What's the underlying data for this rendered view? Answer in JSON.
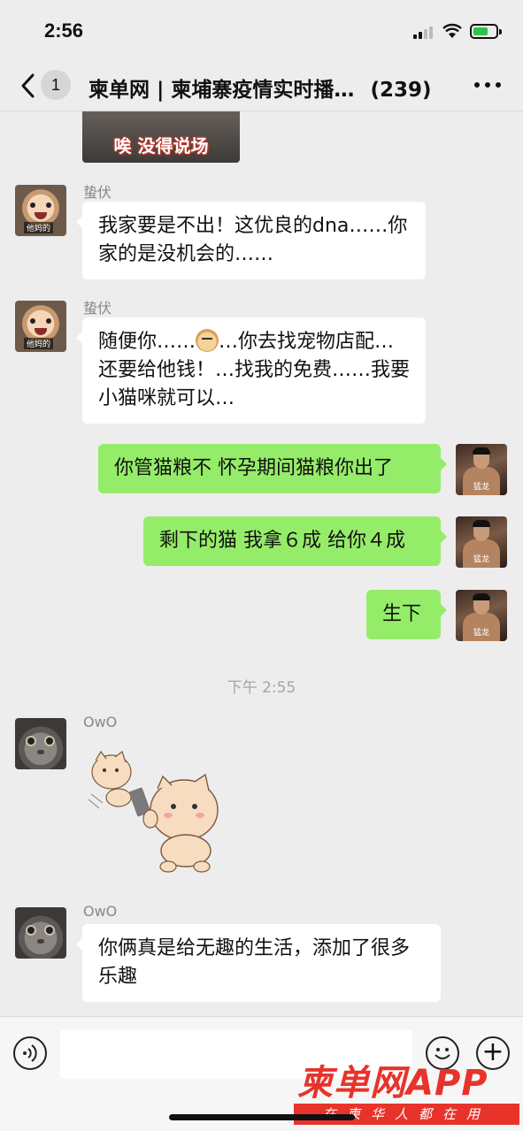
{
  "status_bar": {
    "time": "2:56"
  },
  "header": {
    "unread_count": "1",
    "title": "柬单网 | 柬埔寨疫情实时播…",
    "member_count": "(239)"
  },
  "messages": {
    "sticker_top_caption": "唉 没得说场",
    "msg1": {
      "sender": "蛰伏",
      "text": "我家要是不出！这优良的dna……你家的是没机会的……"
    },
    "msg2": {
      "sender": "蛰伏",
      "text_before": "随便你……",
      "text_after": "…你去找宠物店配…还要给他钱！…找我的免费……我要小猫咪就可以…"
    },
    "msg3": {
      "text": "你管猫粮不 怀孕期间猫粮你出了"
    },
    "msg4": {
      "text": "剩下的猫 我拿６成 给你４成"
    },
    "msg5": {
      "text": "生下"
    },
    "time_divider": "下午 2:55",
    "msg6": {
      "sender": "OwO"
    },
    "msg7": {
      "sender": "OwO",
      "text": "你俩真是给无趣的生活，添加了很多乐趣"
    }
  },
  "avatars": {
    "baby_tag": "他妈的",
    "bruce_tag": "猛龙"
  },
  "input_bar": {
    "placeholder": ""
  },
  "watermark": {
    "brand": "柬单网APP",
    "tagline": "在柬华人都在用"
  },
  "colors": {
    "bubble_out": "#95ec69",
    "bubble_in": "#ffffff",
    "background": "#ededed",
    "watermark": "#e8332a"
  }
}
